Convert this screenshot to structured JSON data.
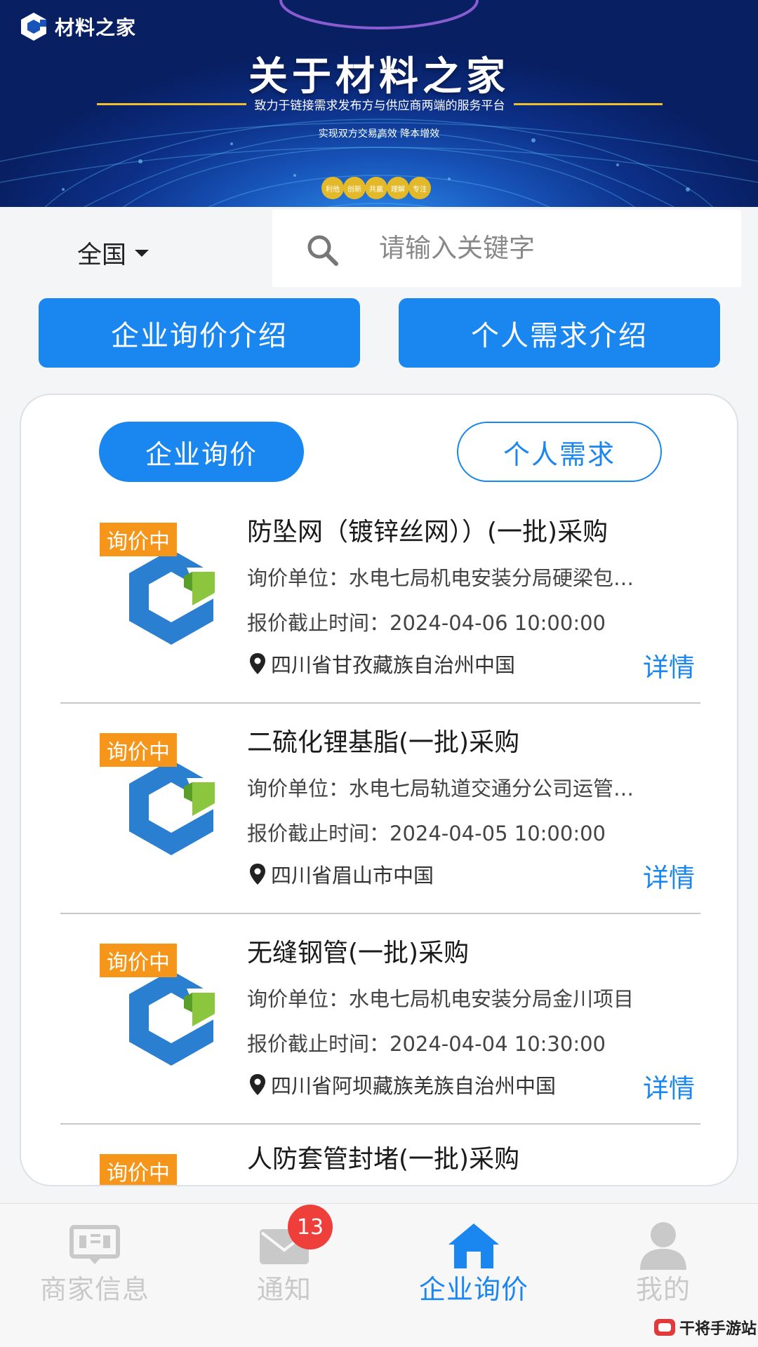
{
  "banner": {
    "logo_text": "材料之家",
    "title": "关于材料之家",
    "subtitle": "致力于链接需求发布方与供应商两端的服务平台",
    "slogan": "实现双方交易高效 降本增效",
    "tags": [
      "利他",
      "创新",
      "共赢",
      "理解",
      "专注"
    ]
  },
  "search": {
    "region": "全国",
    "placeholder": "请输入关键字"
  },
  "intro_buttons": {
    "enterprise": "企业询价介绍",
    "personal": "个人需求介绍"
  },
  "segments": {
    "enterprise": "企业询价",
    "personal": "个人需求"
  },
  "items": [
    {
      "status": "询价中",
      "title": "防坠网（镀锌丝网））(一批)采购",
      "org": "询价单位：水电七局机电安装分局硬梁包…",
      "deadline": "报价截止时间：2024-04-06 10:00:00",
      "location": "四川省甘孜藏族自治州中国",
      "detail": "详情"
    },
    {
      "status": "询价中",
      "title": "二硫化锂基脂(一批)采购",
      "org": "询价单位：水电七局轨道交通分公司运管…",
      "deadline": "报价截止时间：2024-04-05 10:00:00",
      "location": "四川省眉山市中国",
      "detail": "详情"
    },
    {
      "status": "询价中",
      "title": "无缝钢管(一批)采购",
      "org": "询价单位：水电七局机电安装分局金川项目",
      "deadline": "报价截止时间：2024-04-04 10:30:00",
      "location": "四川省阿坝藏族羌族自治州中国",
      "detail": "详情"
    },
    {
      "status": "询价中",
      "title": "人防套管封堵(一批)采购"
    }
  ],
  "tabbar": {
    "tabs": [
      {
        "label": "商家信息",
        "icon": "merchant-info-icon"
      },
      {
        "label": "通知",
        "icon": "mail-icon"
      },
      {
        "label": "企业询价",
        "icon": "home-icon"
      },
      {
        "label": "我的",
        "icon": "user-icon"
      }
    ],
    "notice_badge": "13",
    "active_index": 2
  },
  "watermark": {
    "text": "干将手游站"
  },
  "colors": {
    "primary": "#1a86f0",
    "status": "#f5961b",
    "badge": "#ee3f3a",
    "inactive_tab": "#c9c9c9"
  }
}
